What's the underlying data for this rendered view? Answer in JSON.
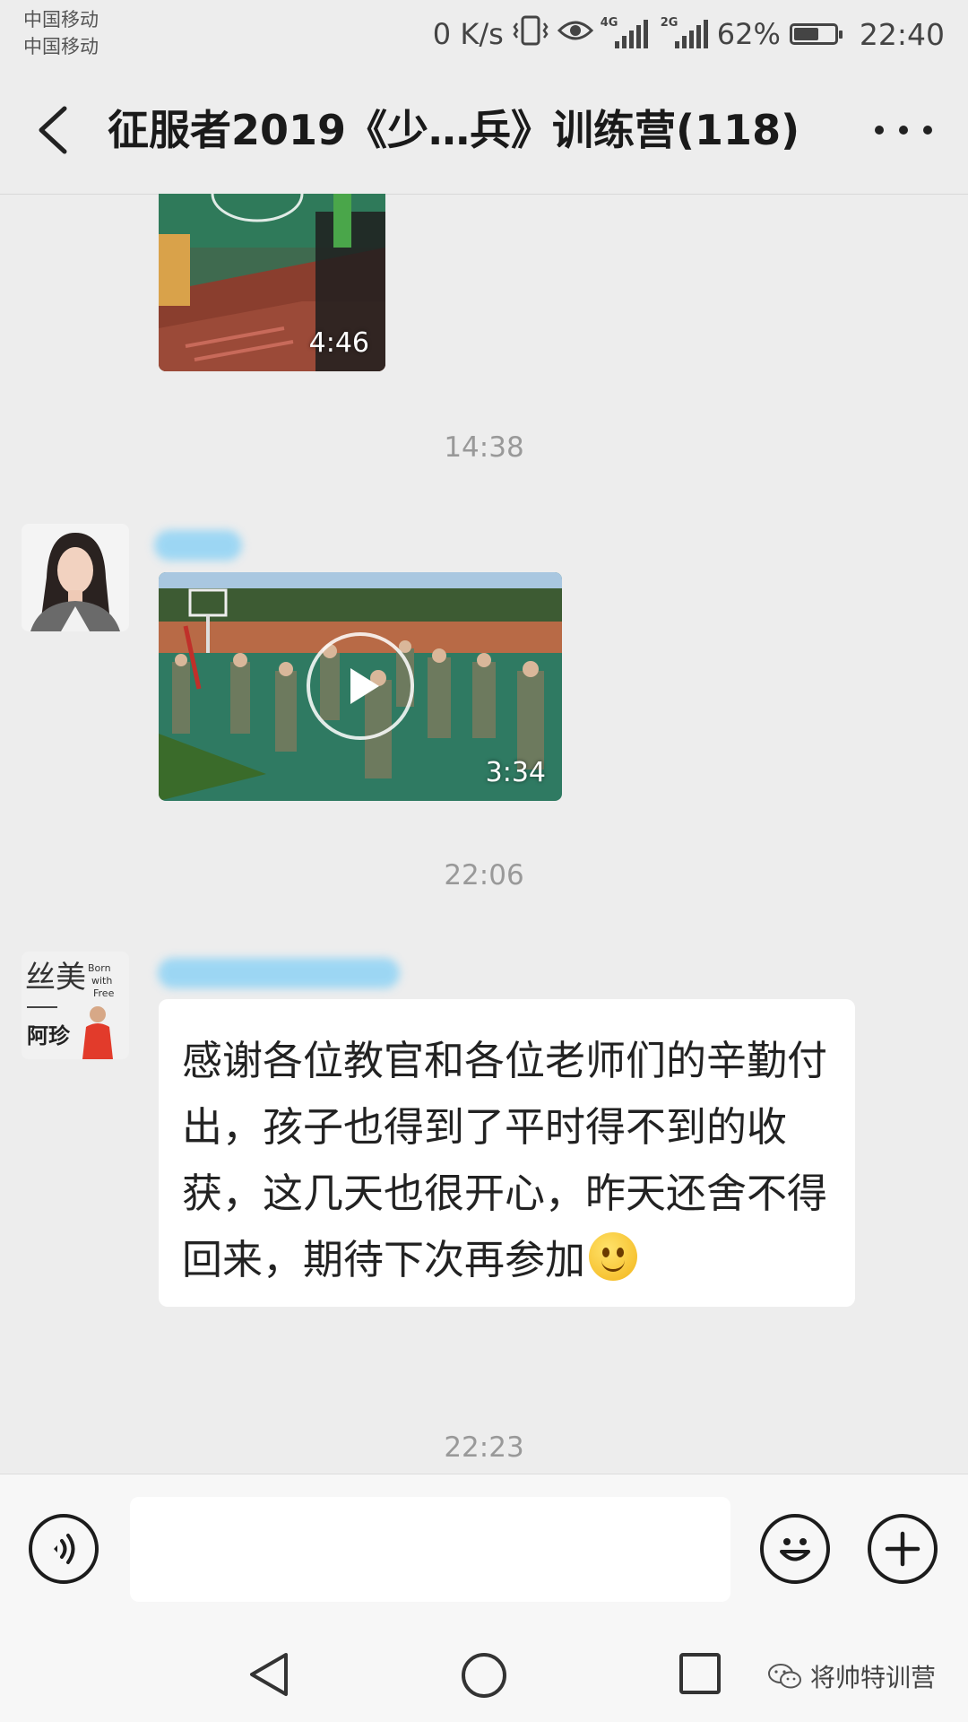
{
  "status_bar": {
    "carrier_1": "中国移动",
    "carrier_2": "中国移动",
    "net_speed": "0 K/s",
    "signal_1_label": "4G",
    "signal_2_label": "2G",
    "battery": "62%",
    "battery_level": 0.62,
    "time": "22:40"
  },
  "header": {
    "title": "征服者2019《少…兵》训练营(118)"
  },
  "messages": [
    {
      "type": "video",
      "duration": "4:46"
    },
    {
      "type": "timestamp",
      "text": "14:38"
    },
    {
      "type": "video",
      "duration": "3:34"
    },
    {
      "type": "timestamp",
      "text": "22:06"
    },
    {
      "type": "text",
      "avatar_text": "阿珍",
      "text": "感谢各位教官和各位老师们的辛勤付出，孩子也得到了平时得不到的收获，这几天也很开心，昨天还舍不得回来，期待下次再参加"
    },
    {
      "type": "timestamp",
      "text": "22:23"
    }
  ],
  "input": {
    "placeholder": ""
  },
  "watermark": "将帅特训营"
}
